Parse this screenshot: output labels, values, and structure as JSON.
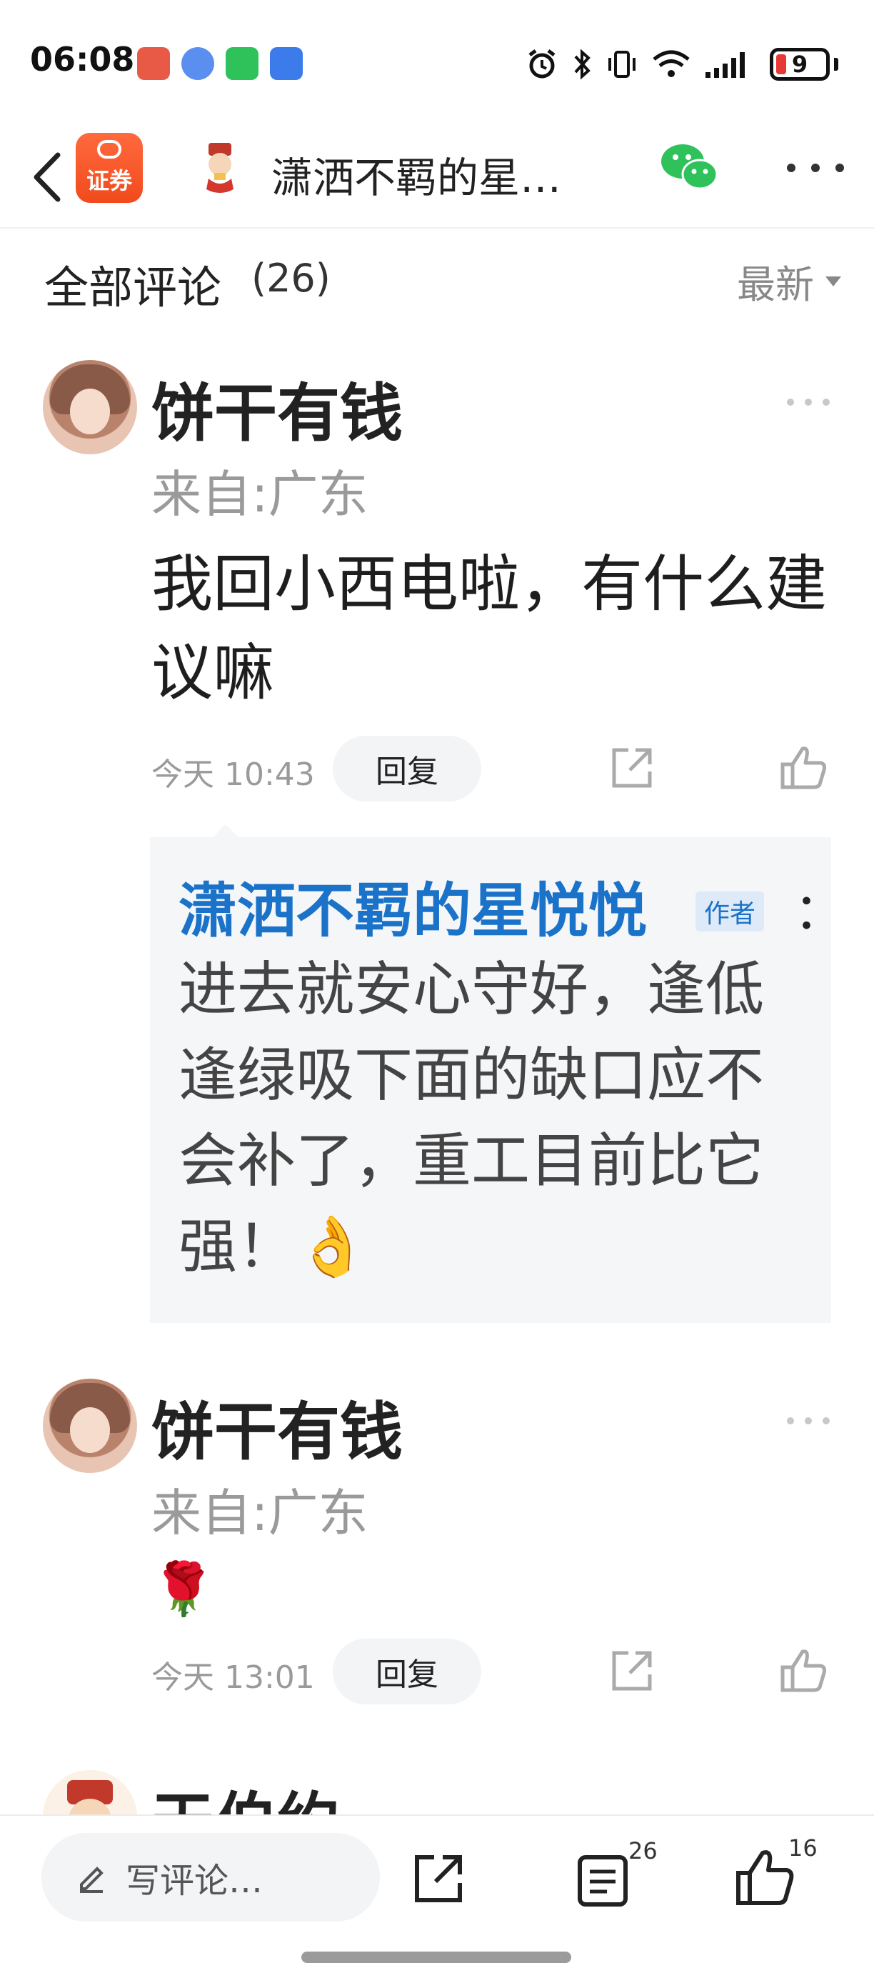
{
  "status_bar": {
    "time": "06:08",
    "battery": "9",
    "notification_colors": [
      "#e85a46",
      "#5a8ff0",
      "#2fc25b",
      "#3b7bea"
    ]
  },
  "header": {
    "title": "潇洒不羁的星…",
    "logo_text": "证券"
  },
  "comments_section": {
    "title": "全部评论",
    "count": "(26)",
    "sort_label": "最新"
  },
  "comments": [
    {
      "username": "饼干有钱",
      "location": "来自:广东",
      "text": "我回小西电啦，有什么建议嘛",
      "time": "今天 10:43",
      "reply_label": "回复",
      "reply": {
        "author": "潇洒不羁的星悦悦",
        "tag": "作者",
        "colon": "：",
        "text": "进去就安心守好，逢低逢绿吸下面的缺口应不会补了，重工目前比它强！👌"
      }
    },
    {
      "username": "饼干有钱",
      "location": "来自:广东",
      "text": "🌹",
      "time": "今天 13:01",
      "reply_label": "回复"
    },
    {
      "username": "天伯约"
    }
  ],
  "bottom_bar": {
    "input_placeholder": "写评论…",
    "comments_count": "26",
    "likes_count": "16"
  },
  "colors": {
    "accent_blue": "#1a73c9",
    "brand_orange": "#f14a1c",
    "wechat_green": "#2fc25b"
  }
}
